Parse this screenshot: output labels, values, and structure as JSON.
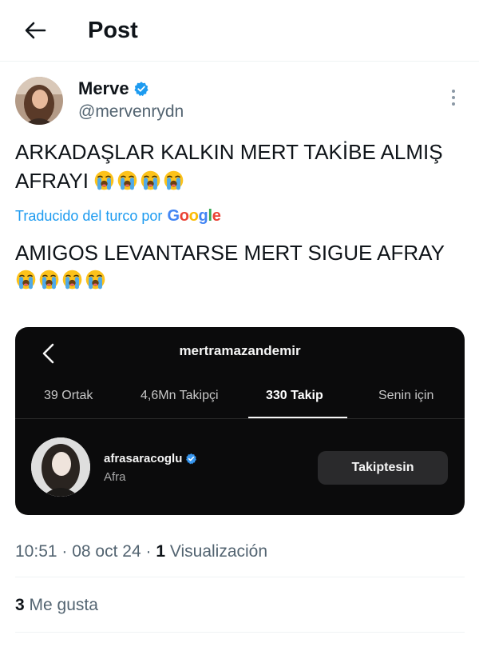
{
  "header": {
    "title": "Post",
    "back_icon": "arrow-left-icon"
  },
  "author": {
    "name": "Merve",
    "handle": "@mervenrydn",
    "verified_icon": "verified-badge-icon",
    "more_icon": "more-vertical-icon"
  },
  "tweet": {
    "text": "ARKADAŞLAR KALKIN MERT TAKİBE ALMIŞ AFRAYI",
    "emoji": "loudly-crying-face",
    "emoji_count": 4
  },
  "translation": {
    "label": "Traducido del turco por",
    "brand": "Google",
    "text": "AMIGOS LEVANTARSE MERT SIGUE AFRAY"
  },
  "embed": {
    "username": "mertramazandemir",
    "back_icon": "chevron-left-icon",
    "tabs": [
      {
        "label": "39 Ortak",
        "active": false
      },
      {
        "label": "4,6Mn Takipçi",
        "active": false
      },
      {
        "label": "330 Takip",
        "active": true
      },
      {
        "label": "Senin için",
        "active": false
      }
    ],
    "user": {
      "username": "afrasaracoglu",
      "full_name": "Afra",
      "button_label": "Takiptesin"
    }
  },
  "meta": {
    "time": "10:51",
    "date": "08 oct 24",
    "views_count": "1",
    "views_label": "Visualización"
  },
  "likes": {
    "count": "3",
    "label": "Me gusta"
  },
  "colors": {
    "link_blue": "#1d9bf0",
    "secondary_text": "#536471",
    "embed_bg": "#0b0b0c"
  }
}
